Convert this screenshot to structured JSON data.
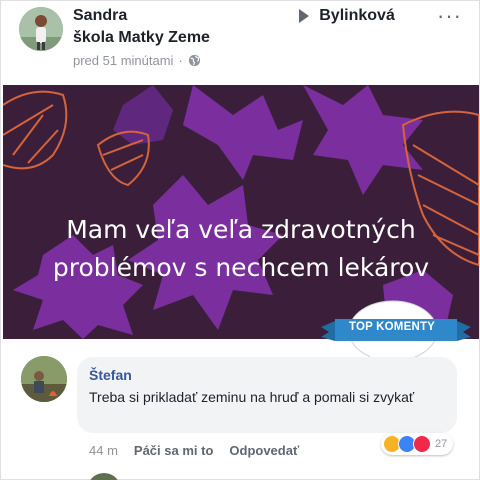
{
  "post": {
    "author": "Sandra",
    "group_arrow_target": "Bylinková",
    "group_name_line2": "škola Matky Zeme",
    "timestamp": "pred 51 minútami",
    "separator": "·",
    "more": "···",
    "image_text_line1": "Mam veľa veľa zdravotných",
    "image_text_line2": "problémov s nechcem lekárov"
  },
  "badge": {
    "label": "TOP KOMENTY"
  },
  "comment": {
    "author": "Štefan",
    "text": "Treba si prikladať zeminu na hruď a pomali si zvykať",
    "time": "44 m",
    "like_label": "Páči sa mi to",
    "reply_label": "Odpovedať",
    "reaction_count": "27",
    "reactions": [
      "haha-icon",
      "like-icon",
      "love-icon"
    ]
  },
  "colors": {
    "accent": "#385898",
    "image_bg": "#3b1f3a",
    "leaf_purple": "#7b2f9f",
    "leaf_orange": "#d5643b",
    "badge_blue": "#2f88c9"
  }
}
